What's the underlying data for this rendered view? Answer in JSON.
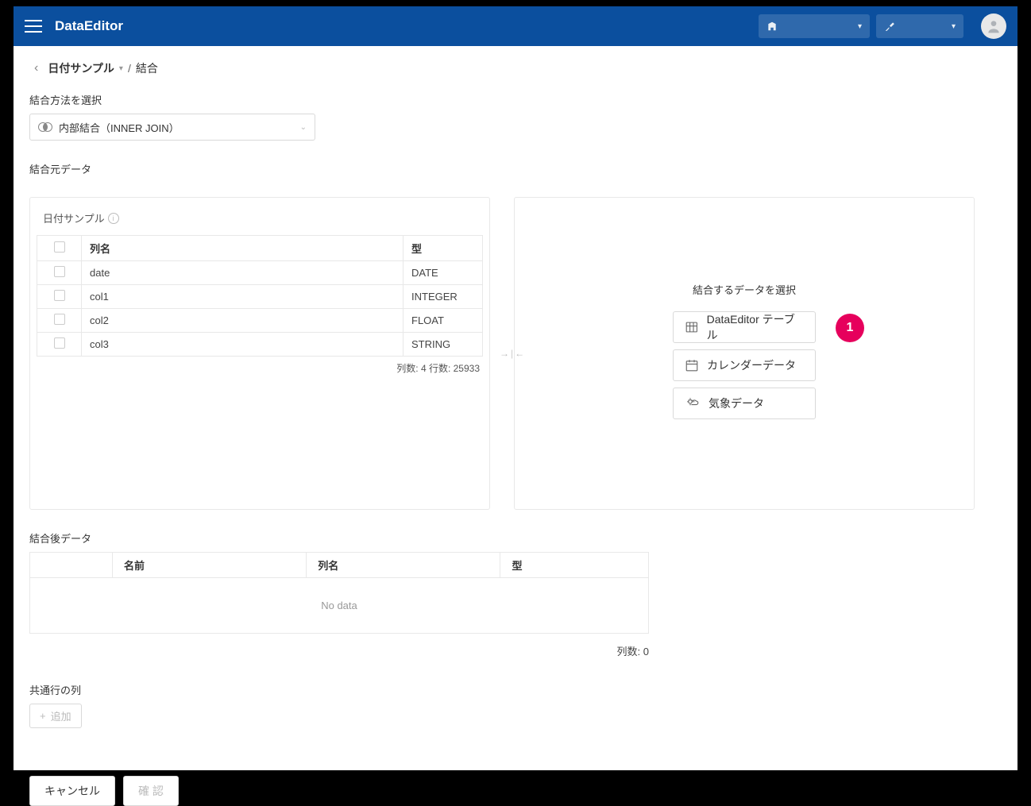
{
  "header": {
    "app_title": "DataEditor"
  },
  "breadcrumb": {
    "item1": "日付サンプル",
    "item2": "結合"
  },
  "join_method": {
    "label": "結合方法を選択",
    "selected": "内部結合（INNER JOIN）"
  },
  "source": {
    "label": "結合元データ",
    "panel_title": "日付サンプル",
    "columns_header": {
      "name": "列名",
      "type": "型"
    },
    "columns": [
      {
        "name": "date",
        "type": "DATE"
      },
      {
        "name": "col1",
        "type": "INTEGER"
      },
      {
        "name": "col2",
        "type": "FLOAT"
      },
      {
        "name": "col3",
        "type": "STRING"
      }
    ],
    "count_text": "列数: 4   行数: 25933"
  },
  "target": {
    "title": "結合するデータを選択",
    "options": [
      {
        "label": "DataEditor テーブル"
      },
      {
        "label": "カレンダーデータ"
      },
      {
        "label": "気象データ"
      }
    ],
    "callout_number": "1"
  },
  "result": {
    "label": "結合後データ",
    "headers": {
      "name": "名前",
      "col": "列名",
      "type": "型"
    },
    "no_data": "No data",
    "count_text": "列数: 0"
  },
  "common": {
    "label": "共通行の列",
    "add_button": "追加"
  },
  "footer": {
    "cancel": "キャンセル",
    "confirm": "確 認"
  }
}
